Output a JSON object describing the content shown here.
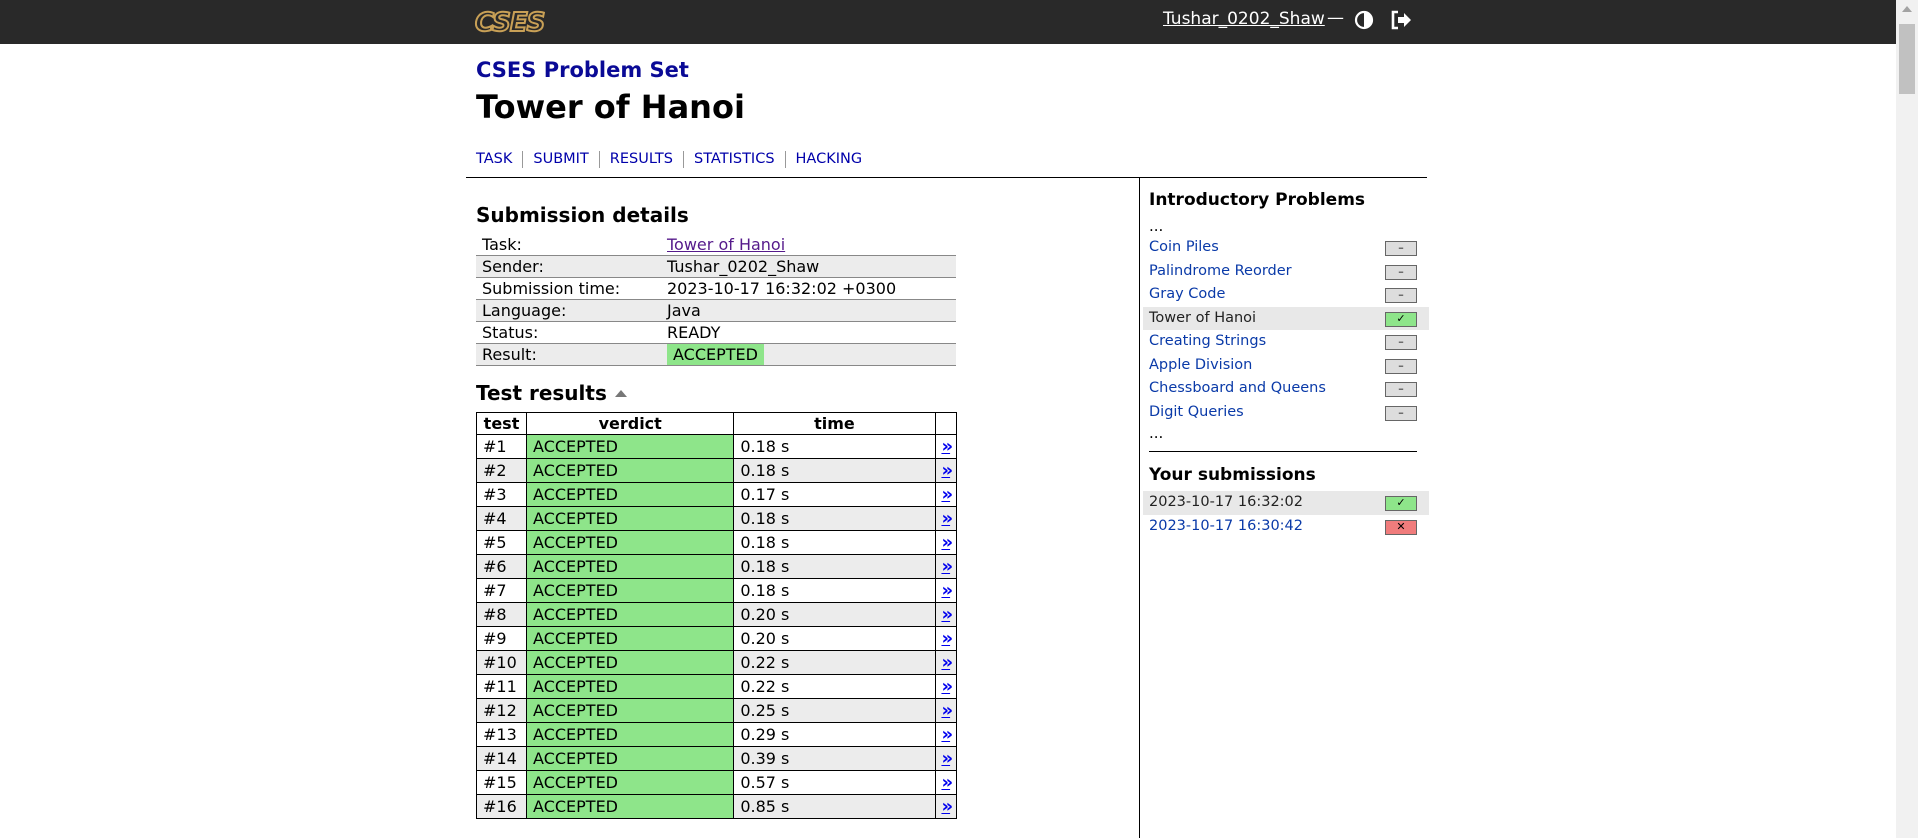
{
  "header": {
    "logo": "CSES",
    "user": "Tushar_0202_Shaw",
    "separator": "—",
    "contrast_icon": "contrast-icon",
    "logout_icon": "logout-icon"
  },
  "page": {
    "set_title": "CSES Problem Set",
    "task_title": "Tower of Hanoi",
    "tabs": [
      "TASK",
      "SUBMIT",
      "RESULTS",
      "STATISTICS",
      "HACKING"
    ]
  },
  "details": {
    "heading": "Submission details",
    "rows": [
      {
        "label": "Task:",
        "value": "Tower of Hanoi"
      },
      {
        "label": "Sender:",
        "value": "Tushar_0202_Shaw"
      },
      {
        "label": "Submission time:",
        "value": "2023-10-17 16:32:02 +0300"
      },
      {
        "label": "Language:",
        "value": "Java"
      },
      {
        "label": "Status:",
        "value": "READY"
      },
      {
        "label": "Result:",
        "value": "ACCEPTED"
      }
    ]
  },
  "tests": {
    "heading": "Test results",
    "columns": [
      "test",
      "verdict",
      "time"
    ],
    "link_glyph": "»",
    "rows": [
      {
        "test": "#1",
        "verdict": "ACCEPTED",
        "time": "0.18 s"
      },
      {
        "test": "#2",
        "verdict": "ACCEPTED",
        "time": "0.18 s"
      },
      {
        "test": "#3",
        "verdict": "ACCEPTED",
        "time": "0.17 s"
      },
      {
        "test": "#4",
        "verdict": "ACCEPTED",
        "time": "0.18 s"
      },
      {
        "test": "#5",
        "verdict": "ACCEPTED",
        "time": "0.18 s"
      },
      {
        "test": "#6",
        "verdict": "ACCEPTED",
        "time": "0.18 s"
      },
      {
        "test": "#7",
        "verdict": "ACCEPTED",
        "time": "0.18 s"
      },
      {
        "test": "#8",
        "verdict": "ACCEPTED",
        "time": "0.20 s"
      },
      {
        "test": "#9",
        "verdict": "ACCEPTED",
        "time": "0.20 s"
      },
      {
        "test": "#10",
        "verdict": "ACCEPTED",
        "time": "0.22 s"
      },
      {
        "test": "#11",
        "verdict": "ACCEPTED",
        "time": "0.22 s"
      },
      {
        "test": "#12",
        "verdict": "ACCEPTED",
        "time": "0.25 s"
      },
      {
        "test": "#13",
        "verdict": "ACCEPTED",
        "time": "0.29 s"
      },
      {
        "test": "#14",
        "verdict": "ACCEPTED",
        "time": "0.39 s"
      },
      {
        "test": "#15",
        "verdict": "ACCEPTED",
        "time": "0.57 s"
      },
      {
        "test": "#16",
        "verdict": "ACCEPTED",
        "time": "0.85 s"
      }
    ]
  },
  "sidebar": {
    "section_heading": "Introductory Problems",
    "ellipsis": "...",
    "problems": [
      {
        "name": "Coin Piles",
        "status": "–",
        "current": false
      },
      {
        "name": "Palindrome Reorder",
        "status": "–",
        "current": false
      },
      {
        "name": "Gray Code",
        "status": "–",
        "current": false
      },
      {
        "name": "Tower of Hanoi",
        "status": "✓",
        "current": true
      },
      {
        "name": "Creating Strings",
        "status": "–",
        "current": false
      },
      {
        "name": "Apple Division",
        "status": "–",
        "current": false
      },
      {
        "name": "Chessboard and Queens",
        "status": "–",
        "current": false
      },
      {
        "name": "Digit Queries",
        "status": "–",
        "current": false
      }
    ],
    "submissions_heading": "Your submissions",
    "submissions": [
      {
        "time": "2023-10-17 16:32:02",
        "status": "✓",
        "current": true
      },
      {
        "time": "2023-10-17 16:30:42",
        "status": "✕",
        "current": false
      }
    ]
  },
  "colors": {
    "header_bg": "#292929",
    "accepted": "#8ee58a",
    "rejected": "#f07c7c",
    "link": "#0000aa"
  }
}
